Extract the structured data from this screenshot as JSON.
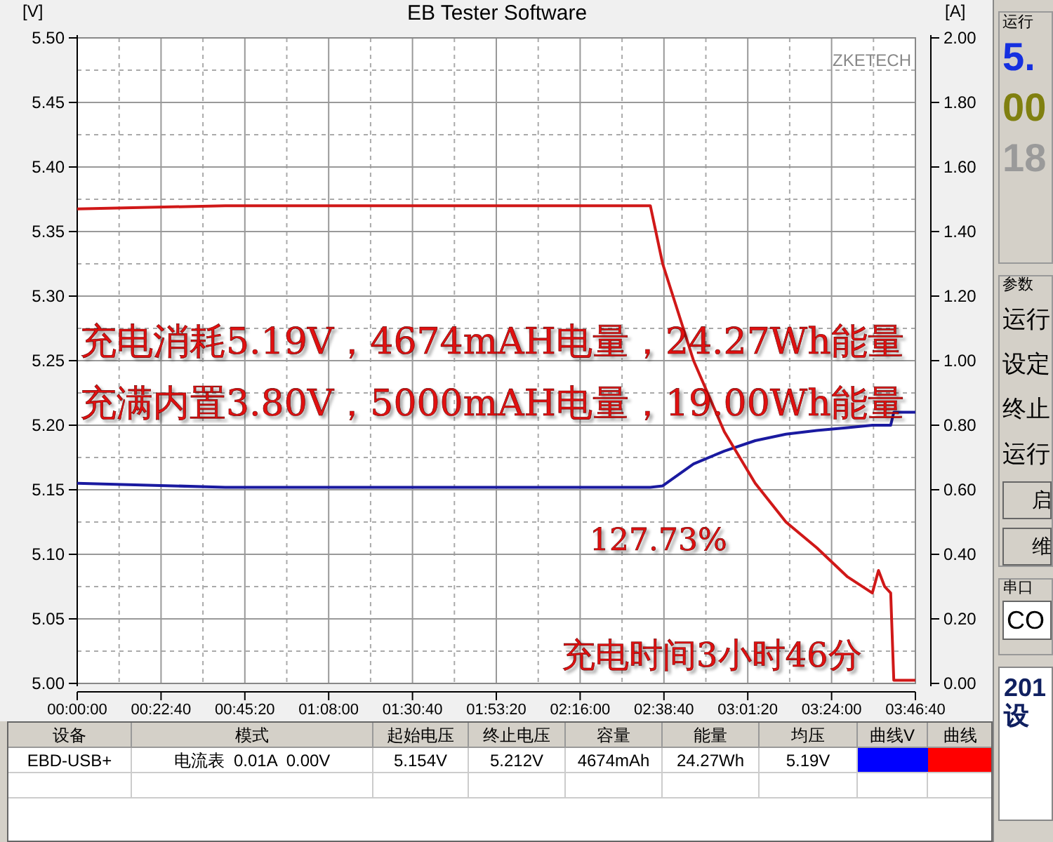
{
  "chart": {
    "watermark": "ZKETECH",
    "chart_data": {
      "type": "line",
      "title": "EB Tester Software",
      "ylabel": "[V]",
      "y2label": "[A]",
      "x": [
        0,
        2400,
        4800,
        7200,
        9300,
        9500,
        10000,
        10500,
        11000,
        11500,
        12000,
        12500,
        12900,
        13000,
        13100,
        13200,
        13250,
        13600
      ],
      "grid": true,
      "xlim": [
        0,
        13600
      ],
      "ylim": [
        5.0,
        5.5
      ],
      "y2lim": [
        0,
        2
      ],
      "xticks": [
        {
          "value": 0,
          "label": "00:00:00"
        },
        {
          "value": 1360,
          "label": "00:22:40"
        },
        {
          "value": 2720,
          "label": "00:45:20"
        },
        {
          "value": 4080,
          "label": "01:08:00"
        },
        {
          "value": 5440,
          "label": "01:30:40"
        },
        {
          "value": 6800,
          "label": "01:53:20"
        },
        {
          "value": 8160,
          "label": "02:16:00"
        },
        {
          "value": 9520,
          "label": "02:38:40"
        },
        {
          "value": 10880,
          "label": "03:01:20"
        },
        {
          "value": 12240,
          "label": "03:24:00"
        },
        {
          "value": 13600,
          "label": "03:46:40"
        }
      ],
      "yticks": [
        {
          "value": 5.0,
          "label": "5.00"
        },
        {
          "value": 5.05,
          "label": "5.05"
        },
        {
          "value": 5.1,
          "label": "5.10"
        },
        {
          "value": 5.15,
          "label": "5.15"
        },
        {
          "value": 5.2,
          "label": "5.20"
        },
        {
          "value": 5.25,
          "label": "5.25"
        },
        {
          "value": 5.3,
          "label": "5.30"
        },
        {
          "value": 5.35,
          "label": "5.35"
        },
        {
          "value": 5.4,
          "label": "5.40"
        },
        {
          "value": 5.45,
          "label": "5.45"
        },
        {
          "value": 5.5,
          "label": "5.50"
        }
      ],
      "y2ticks": [
        {
          "value": 0,
          "label": "0.00"
        },
        {
          "value": 0.2,
          "label": "0.20"
        },
        {
          "value": 0.4,
          "label": "0.40"
        },
        {
          "value": 0.6,
          "label": "0.60"
        },
        {
          "value": 0.8,
          "label": "0.80"
        },
        {
          "value": 1.0,
          "label": "1.00"
        },
        {
          "value": 1.2,
          "label": "1.20"
        },
        {
          "value": 1.4,
          "label": "1.40"
        },
        {
          "value": 1.6,
          "label": "1.60"
        },
        {
          "value": 1.8,
          "label": "1.80"
        },
        {
          "value": 2.0,
          "label": "2.00"
        }
      ],
      "series": [
        {
          "color": "#1a1aa0",
          "values": [
            5.155,
            5.152,
            5.152,
            5.152,
            5.152,
            5.153,
            5.17,
            5.18,
            5.188,
            5.193,
            5.196,
            5.198,
            5.2,
            5.2,
            5.2,
            5.2,
            5.21,
            5.21
          ]
        },
        {
          "color": "#d01818",
          "axis": "y2",
          "values": [
            1.47,
            1.48,
            1.48,
            1.48,
            1.48,
            1.3,
            1.0,
            0.78,
            0.62,
            0.5,
            0.42,
            0.33,
            0.28,
            0.35,
            0.3,
            0.28,
            0.01,
            0.01
          ]
        }
      ],
      "annotations": [
        "充电消耗5.19V，4674mAH电量，24.27Wh能量",
        "充满内置3.80V，5000mAH电量，19.00Wh能量",
        "127.73%",
        "充电时间3小时46分"
      ]
    }
  },
  "side_panel": {
    "run_group": "运行",
    "readings": [
      {
        "text": "5.",
        "color": "#1530e0"
      },
      {
        "text": "00",
        "color": "#808010"
      },
      {
        "text": "18",
        "color": "#9a9a9a"
      }
    ],
    "param_group": "参数",
    "param_labels": [
      "运行",
      "设定",
      "终止",
      "运行"
    ],
    "buttons": [
      "启",
      "维"
    ],
    "serial_group": "串口",
    "serial_field": "CO",
    "footer_lines": [
      "201",
      "设"
    ]
  },
  "table": {
    "columns": [
      "设备",
      "模式",
      "起始电压",
      "终止电压",
      "容量",
      "能量",
      "均压",
      "曲线V",
      "曲线"
    ],
    "rows": [
      {
        "cells": [
          "EBD-USB+",
          "电流表  0.01A  0.00V",
          "5.154V",
          "5.212V",
          "4674mAh",
          "24.27Wh",
          "5.19V"
        ],
        "curves": [
          {
            "color": "#0000ff"
          },
          {
            "color": "#ff0000"
          }
        ]
      }
    ]
  }
}
